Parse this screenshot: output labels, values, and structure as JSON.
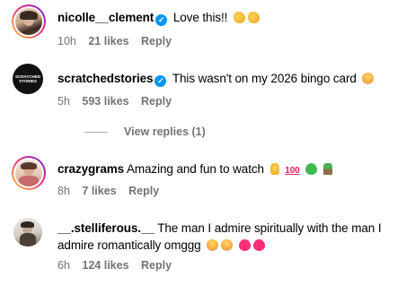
{
  "comments": [
    {
      "username": "nicolle__clement",
      "verified": true,
      "text": "Love this!!",
      "emojis": [
        "clapping-hands",
        "clapping-hands"
      ],
      "time": "10h",
      "likes": "21 likes",
      "reply": "Reply"
    },
    {
      "username": "scratchedstories",
      "avatar_text": "SCRATCHED STORIES",
      "verified": true,
      "text": "This wasn't on my 2026 bingo card",
      "emojis": [
        "face-screaming"
      ],
      "time": "5h",
      "likes": "593 likes",
      "reply": "Reply",
      "view_replies": "View replies (1)"
    },
    {
      "username": "crazygrams",
      "verified": false,
      "text": "Amazing and fun to watch",
      "emojis": [
        "thumbs-up",
        "hundred-points",
        "green-heart",
        "seedling"
      ],
      "hundred_label": "100",
      "time": "8h",
      "likes": "7 likes",
      "reply": "Reply"
    },
    {
      "username": "__.stelliferous.__",
      "verified": false,
      "text_line1": "The man I admire spiritually with the man I",
      "text_line2": "admire romantically omggg",
      "emojis": [
        "face-screaming",
        "face-screaming",
        "pink-heart",
        "pink-heart"
      ],
      "time": "6h",
      "likes": "124 likes",
      "reply": "Reply"
    }
  ],
  "colors": {
    "verified": "#0095f6",
    "meta_text": "#737373",
    "story_ring_start": "#f9ce34",
    "story_ring_end": "#6228d7"
  }
}
